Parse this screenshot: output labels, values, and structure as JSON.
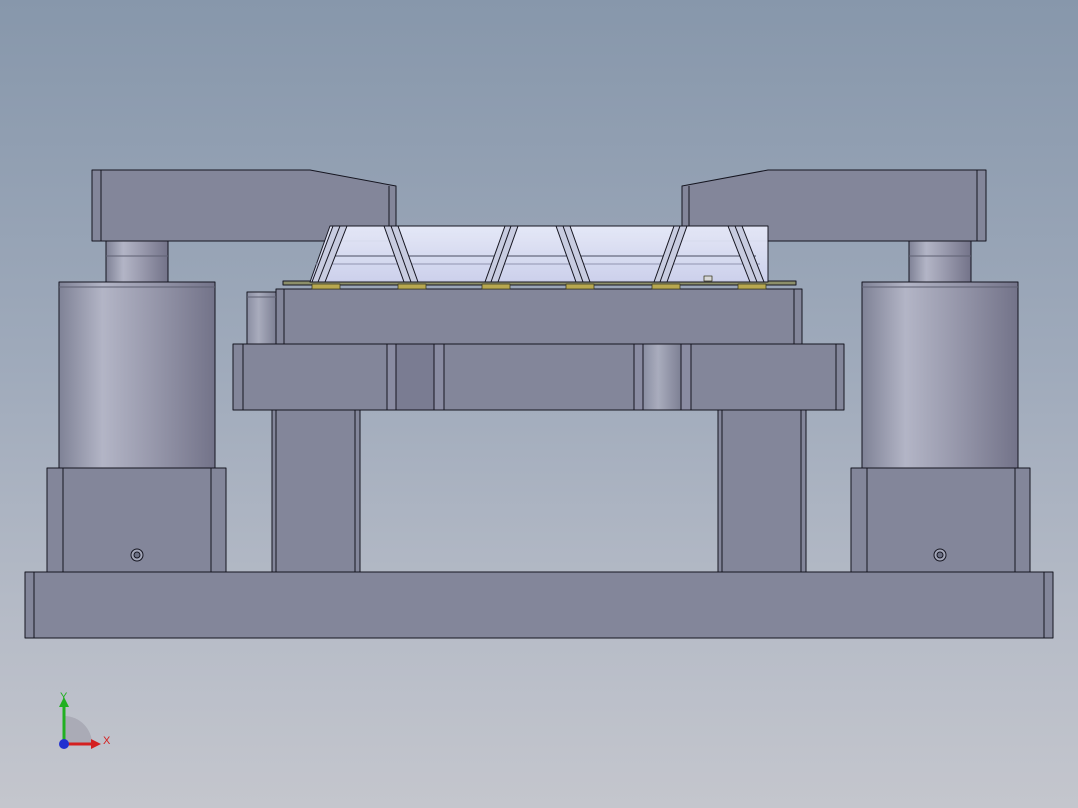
{
  "triad": {
    "x_label": "X",
    "y_label": "Y",
    "x_color": "#d42020",
    "y_color": "#21b021",
    "z_color": "#2030d0"
  },
  "colors": {
    "steel": "#82889a",
    "steel_light": "#a3a6b8",
    "steel_dark": "#6c7084",
    "edge": "#151520",
    "glass": "#dfe3f5",
    "pcb": "#8c8f6a"
  }
}
